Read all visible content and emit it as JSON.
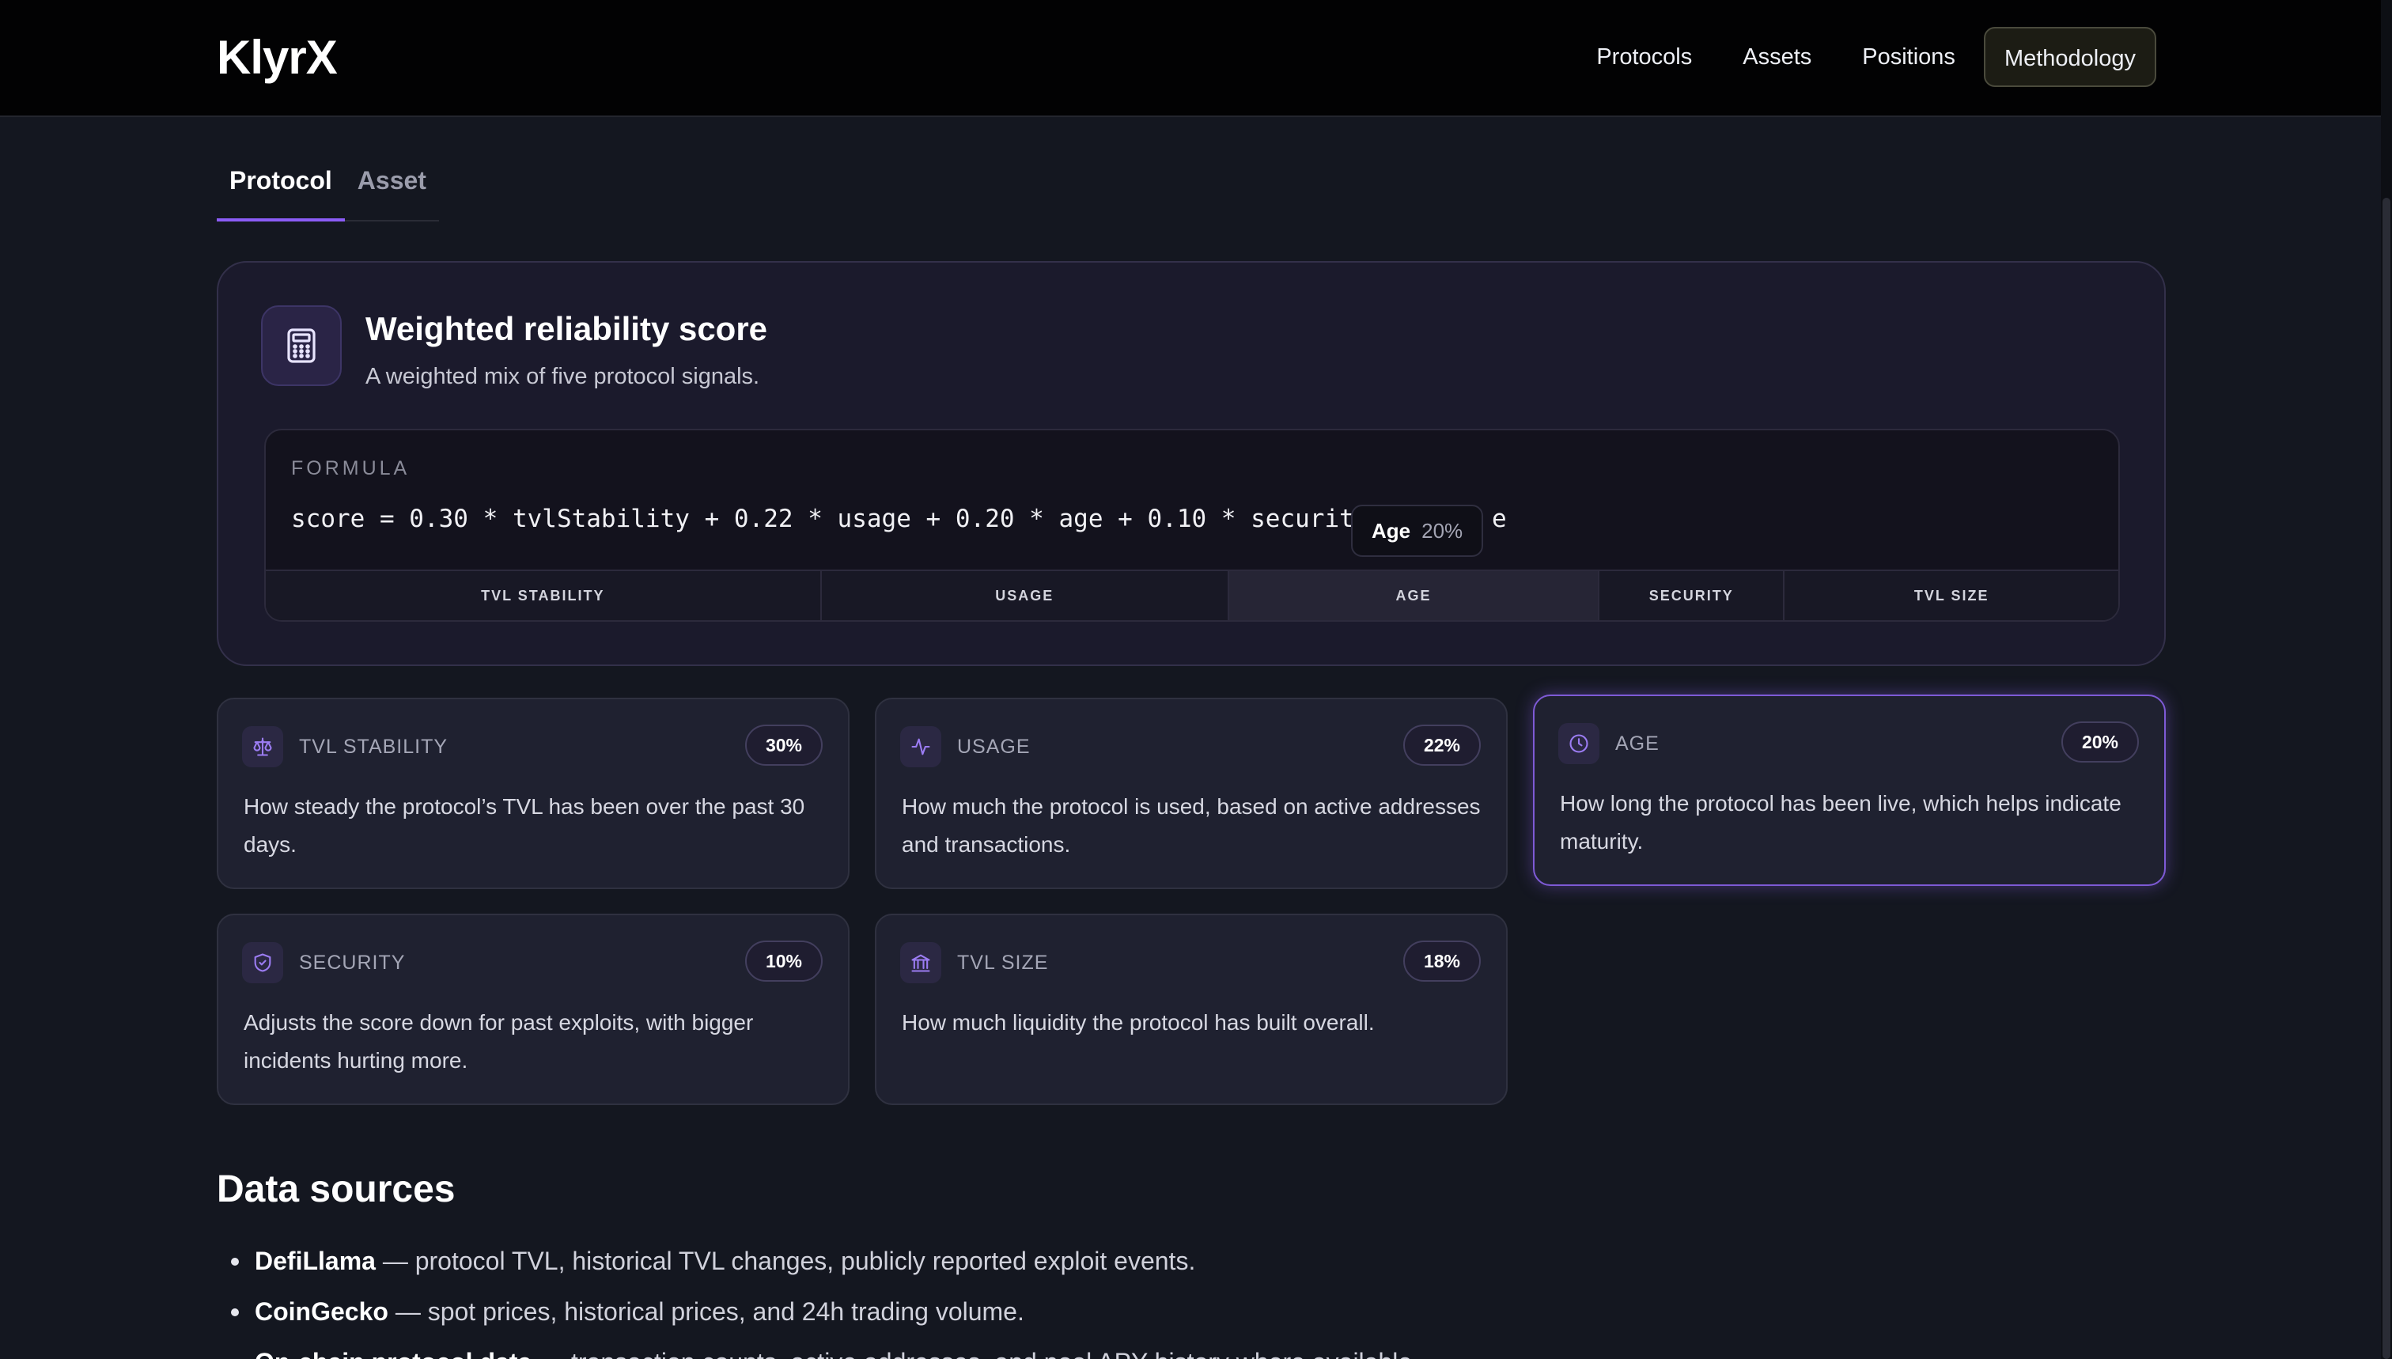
{
  "header": {
    "logo": "KlyrX",
    "nav": [
      {
        "label": "Protocols",
        "active": false
      },
      {
        "label": "Assets",
        "active": false
      },
      {
        "label": "Positions",
        "active": false
      },
      {
        "label": "Methodology",
        "active": true
      }
    ]
  },
  "tabs": [
    {
      "label": "Protocol",
      "active": true
    },
    {
      "label": "Asset",
      "active": false
    }
  ],
  "score_card": {
    "icon": "calculator-icon",
    "title": "Weighted reliability score",
    "subtitle": "A weighted mix of five protocol signals.",
    "formula_label": "FORMULA",
    "formula_visible": "score = 0.30 * tvlStability + 0.22 * usage + 0.20 * age + 0.10 * security + 0.18",
    "formula_tail": "e",
    "tooltip": {
      "name": "Age",
      "value": "20%"
    },
    "segments": [
      {
        "label": "TVL STABILITY",
        "weight": 30
      },
      {
        "label": "USAGE",
        "weight": 22
      },
      {
        "label": "AGE",
        "weight": 20,
        "hover": true
      },
      {
        "label": "SECURITY",
        "weight": 10
      },
      {
        "label": "TVL SIZE",
        "weight": 18
      }
    ]
  },
  "factors": [
    {
      "icon": "scale-icon",
      "label": "TVL STABILITY",
      "weight": "30%",
      "desc": "How steady the protocol’s TVL has been over the past 30 days."
    },
    {
      "icon": "activity-icon",
      "label": "USAGE",
      "weight": "22%",
      "desc": "How much the protocol is used, based on active addresses and transactions."
    },
    {
      "icon": "clock-icon",
      "label": "AGE",
      "weight": "20%",
      "desc": "How long the protocol has been live, which helps indicate maturity.",
      "active": true
    },
    {
      "icon": "shield-icon",
      "label": "SECURITY",
      "weight": "10%",
      "desc": "Adjusts the score down for past exploits, with bigger incidents hurting more."
    },
    {
      "icon": "bank-icon",
      "label": "TVL SIZE",
      "weight": "18%",
      "desc": "How much liquidity the protocol has built overall."
    }
  ],
  "data_sources": {
    "title": "Data sources",
    "items": [
      {
        "name": "DefiLlama",
        "desc": " — protocol TVL, historical TVL changes, publicly reported exploit events."
      },
      {
        "name": "CoinGecko",
        "desc": " — spot prices, historical prices, and 24h trading volume."
      },
      {
        "name": "On-chain protocol data",
        "desc": " — transaction counts, active addresses, and pool APY history where available."
      }
    ]
  }
}
